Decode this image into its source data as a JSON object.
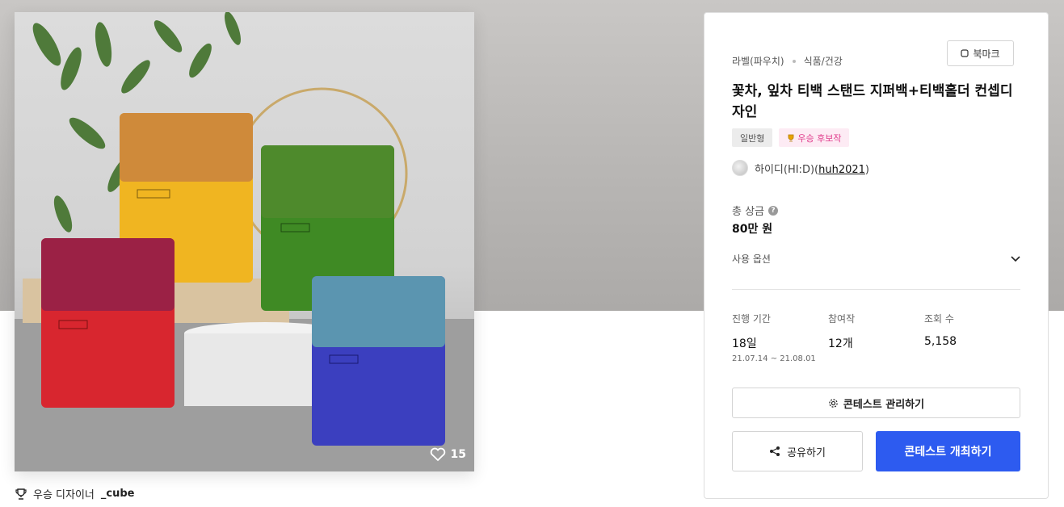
{
  "colors": {
    "accent": "#2d5bf0",
    "badge_pink": "#e03b8b",
    "background_band": "#bdbbb9"
  },
  "image": {
    "description_icons": [
      "heart-icon"
    ],
    "like_count": "15",
    "pouches": [
      {
        "name": "orange-yellow-pouch",
        "top_color": "#cf8a3a",
        "bottom_color": "#f0b521"
      },
      {
        "name": "green-pouch",
        "top_color": "#4e8a2c",
        "bottom_color": "#3f8a24"
      },
      {
        "name": "red-pouch",
        "top_color": "#9b2145",
        "bottom_color": "#d8262f"
      },
      {
        "name": "blue-pouch",
        "top_color": "#5b95b0",
        "bottom_color": "#3b3fbf"
      }
    ]
  },
  "winner": {
    "label": "우승 디자이너",
    "name": "_cube"
  },
  "panel": {
    "category": "라벨(파우치)",
    "subcategory": "식품/건강",
    "bookmark_label": "북마크",
    "title": "꽃차, 잎차 티백 스탠드 지퍼백+티백홀더 컨셉디자인",
    "tags": {
      "type": "일반형",
      "candidate": "우승 후보작"
    },
    "host": {
      "name": "하이디(HI:D)",
      "open": "(",
      "id": "huh2021",
      "close": ")"
    },
    "prize_label": "총 상금",
    "prize_value": "80만 원",
    "usage_label": "사용 옵션",
    "stats": {
      "period_label": "진행 기간",
      "period_value": "18일",
      "period_range": "21.07.14 ~ 21.08.01",
      "entries_label": "참여작",
      "entries_value": "12개",
      "views_label": "조회 수",
      "views_value": "5,158"
    },
    "manage_label": "콘테스트 관리하기",
    "share_label": "공유하기",
    "host_contest_label": "콘테스트 개최하기"
  }
}
